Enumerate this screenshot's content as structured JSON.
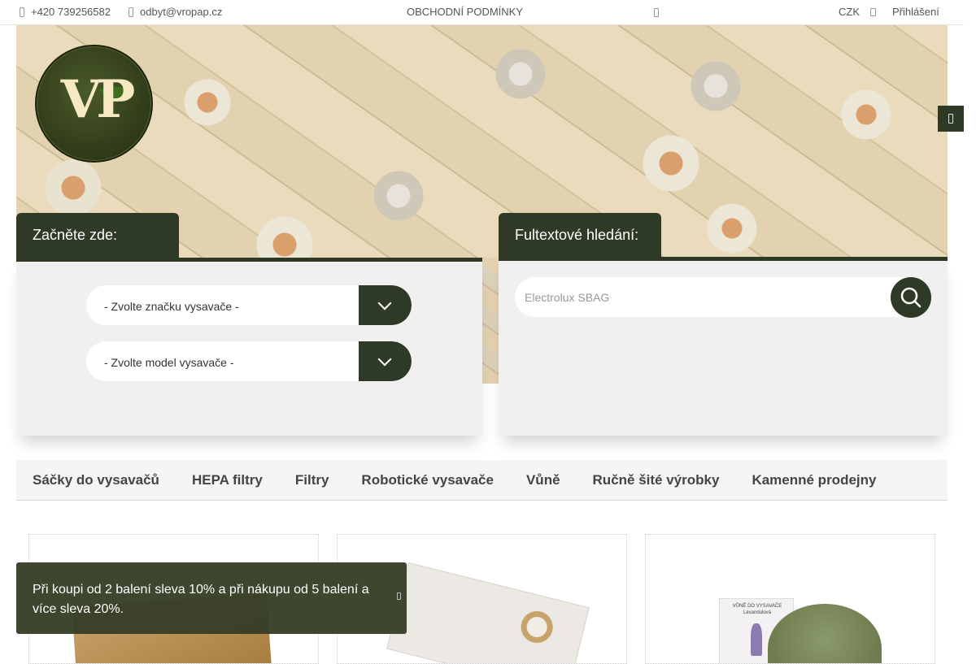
{
  "topbar": {
    "phone": "+420 739256582",
    "email": "odbyt@vropap.cz",
    "terms_link": "OBCHODNÍ PODMÍNKY",
    "currency": "CZK",
    "login": "Přihlášení"
  },
  "logo": {
    "text": "VP"
  },
  "finder": {
    "title": "Začněte zde:",
    "brand_select": "- Zvolte značku vysavače -",
    "model_select": "- Zvolte model vysavače -"
  },
  "fulltext": {
    "title": "Fultextové hledání:",
    "placeholder": "Electrolux SBAG"
  },
  "categories": [
    "Sáčky do vysavačů",
    "HEPA filtry",
    "Filtry",
    "Robotické vysavače",
    "Vůně",
    "Ručně šité výrobky",
    "Kamenné prodejny"
  ],
  "products": {
    "card3_label_line1": "VŮNĚ DO VYSAVAČE",
    "card3_label_line2": "Levandulová"
  },
  "toast": {
    "message": "Při koupi od 2 balení sleva 10% a při nákupu od 5 balení a více sleva 20%."
  },
  "colors": {
    "brand_dark": "#2f3a26",
    "panel_bg": "#f0f0f0"
  },
  "icons": [
    "phone-icon",
    "mail-icon",
    "cart-icon",
    "user-icon",
    "side-tab-icon",
    "chevron-down-icon",
    "search-icon",
    "close-icon"
  ]
}
